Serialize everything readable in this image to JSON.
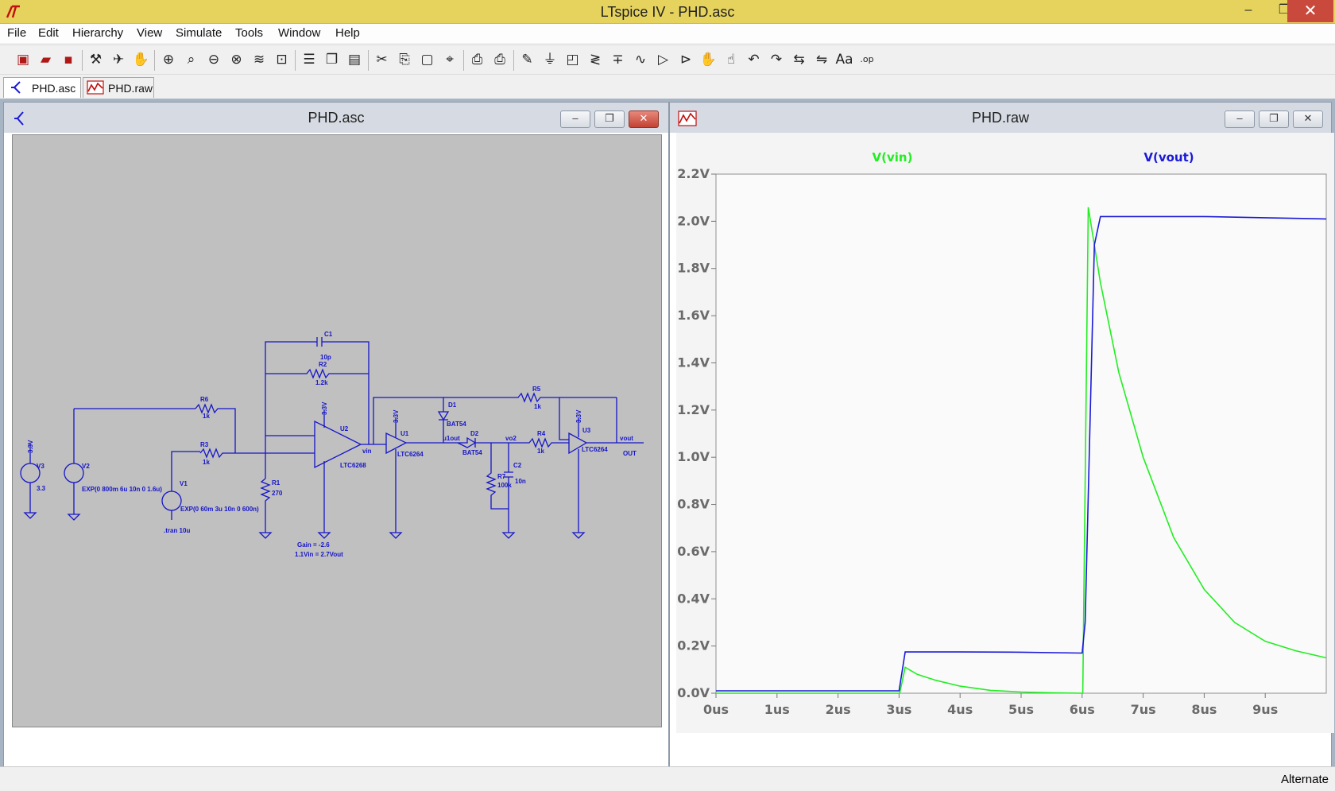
{
  "app": {
    "title": "LTspice IV - PHD.asc",
    "window_buttons": {
      "minimize": "–",
      "restore": "❐",
      "close": "✕"
    }
  },
  "menu": [
    "File",
    "Edit",
    "Hierarchy",
    "View",
    "Simulate",
    "Tools",
    "Window",
    "Help"
  ],
  "toolbar_icons": [
    "new-schematic-icon",
    "open-icon",
    "save-icon",
    "control-panel-icon",
    "run-icon",
    "halt-icon",
    "zoom-in-icon",
    "zoom-pan-icon",
    "zoom-out-icon",
    "zoom-fit-icon",
    "autorange-icon",
    "delete-axes-icon",
    "tile-horizontal-icon",
    "cascade-icon",
    "tile-vertical-icon",
    "cut-icon",
    "copy-icon",
    "paste-icon",
    "find-icon",
    "print-setup-icon",
    "print-icon",
    "wire-icon",
    "ground-icon",
    "label-net-icon",
    "resistor-icon",
    "capacitor-icon",
    "inductor-icon",
    "diode-icon",
    "component-icon",
    "move-icon",
    "drag-icon",
    "undo-icon",
    "redo-icon",
    "rotate-icon",
    "mirror-icon",
    "text-icon",
    "spice-directive-icon"
  ],
  "tabs": [
    {
      "label": "PHD.asc",
      "icon": "schematic-icon",
      "active": true
    },
    {
      "label": "PHD.raw",
      "icon": "waveform-icon",
      "active": false
    }
  ],
  "schematic_window": {
    "title": "PHD.asc",
    "buttons": {
      "minimize": "–",
      "restore": "❐",
      "close": "✕"
    },
    "labels": {
      "c1": "C1",
      "c1_val": "10p",
      "r2": "R2",
      "r2_val": "1.2k",
      "r6": "R6",
      "r6_val": "1k",
      "r3": "R3",
      "r3_val": "1k",
      "r5": "R5",
      "r5_val": "1k",
      "r1": "R1",
      "r1_val": "270",
      "r4": "R4",
      "r4_val": "1k",
      "r7": "R7",
      "r7_val": "100k",
      "c2": "C2",
      "c2_val": "10n",
      "d1": "D1",
      "d1_val": "BAT54",
      "d2": "D2",
      "d2_val": "BAT54",
      "u1": "U1",
      "u1_val": "LTC6264",
      "u2": "U2",
      "u2_val": "LTC6268",
      "u3": "U3",
      "u3_val": "LTC6264",
      "v1": "V1",
      "v1_val": "EXP(0 60m 3u 10n 0 600n)",
      "v2": "V2",
      "v2_val": "EXP(0 800m 6u 10n 0 1.6u)",
      "v3": "V3",
      "v3_val": "3.3",
      "supply": "3.3V",
      "net_vin": "vin",
      "net_u1out": "u1out",
      "net_vo2": "vo2",
      "net_vout": "vout",
      "out_flag": "OUT",
      "tran": ".tran 10u",
      "gain_note": "Gain = -2.6",
      "gain_note2": "1.1Vin = 2.7Vout"
    }
  },
  "plot_window": {
    "title": "PHD.raw",
    "buttons": {
      "minimize": "–",
      "restore": "❐",
      "close": "✕"
    }
  },
  "chart_data": {
    "type": "line",
    "title": "",
    "xlabel": "",
    "ylabel": "",
    "xlim": [
      0,
      10
    ],
    "ylim": [
      0,
      2.2
    ],
    "x_ticks": [
      "0us",
      "1us",
      "2us",
      "3us",
      "4us",
      "5us",
      "6us",
      "7us",
      "8us",
      "9us"
    ],
    "x_tick_values": [
      0,
      1,
      2,
      3,
      4,
      5,
      6,
      7,
      8,
      9
    ],
    "y_ticks": [
      "0.0V",
      "0.2V",
      "0.4V",
      "0.6V",
      "0.8V",
      "1.0V",
      "1.2V",
      "1.4V",
      "1.6V",
      "1.8V",
      "2.0V",
      "2.2V"
    ],
    "y_tick_values": [
      0,
      0.2,
      0.4,
      0.6,
      0.8,
      1.0,
      1.2,
      1.4,
      1.6,
      1.8,
      2.0,
      2.2
    ],
    "grid": false,
    "legend": "top",
    "series": [
      {
        "name": "V(vin)",
        "color": "#22ee22",
        "x": [
          0,
          3.0,
          3.01,
          3.1,
          3.3,
          3.6,
          4.0,
          4.5,
          5.0,
          5.5,
          6.0,
          6.01,
          6.1,
          6.3,
          6.6,
          7.0,
          7.5,
          8.0,
          8.5,
          9.0,
          9.5,
          10.0
        ],
        "y": [
          0.0,
          0.0,
          0.0,
          0.11,
          0.08,
          0.055,
          0.03,
          0.012,
          0.005,
          0.002,
          0.0,
          0.0,
          2.06,
          1.74,
          1.36,
          1.0,
          0.66,
          0.44,
          0.3,
          0.22,
          0.18,
          0.15
        ]
      },
      {
        "name": "V(vout)",
        "color": "#1a1ad8",
        "x": [
          0,
          3.0,
          3.1,
          4.0,
          5.0,
          6.0,
          6.05,
          6.2,
          6.3,
          7.0,
          8.0,
          9.0,
          10.0
        ],
        "y": [
          0.01,
          0.01,
          0.175,
          0.175,
          0.174,
          0.17,
          0.3,
          1.9,
          2.02,
          2.02,
          2.02,
          2.015,
          2.01
        ]
      }
    ]
  },
  "status": {
    "text": "Alternate"
  }
}
